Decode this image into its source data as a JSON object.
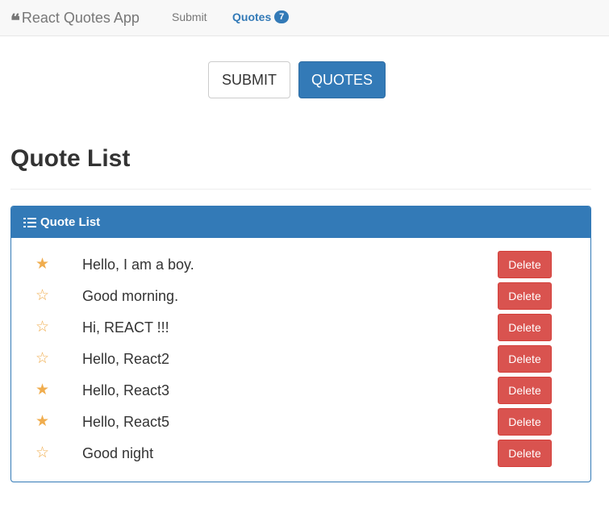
{
  "navbar": {
    "brand": "React Quotes App",
    "brand_icon": "quote-left-icon",
    "links": [
      {
        "label": "Submit"
      },
      {
        "label": "Quotes",
        "badge": "7"
      }
    ]
  },
  "buttons": {
    "submit_label": "SUBMIT",
    "quotes_label": "QUOTES"
  },
  "page_title": "Quote List",
  "panel": {
    "title": "Quote List",
    "icon": "list-icon"
  },
  "quotes": [
    {
      "text": "Hello, I am a boy.",
      "starred": true,
      "delete_label": "Delete"
    },
    {
      "text": "Good morning.",
      "starred": false,
      "delete_label": "Delete"
    },
    {
      "text": "Hi, REACT !!!",
      "starred": false,
      "delete_label": "Delete"
    },
    {
      "text": "Hello, React2",
      "starred": false,
      "delete_label": "Delete"
    },
    {
      "text": "Hello, React3",
      "starred": true,
      "delete_label": "Delete"
    },
    {
      "text": "Hello, React5",
      "starred": true,
      "delete_label": "Delete"
    },
    {
      "text": "Good night",
      "starred": false,
      "delete_label": "Delete"
    }
  ],
  "colors": {
    "primary": "#337ab7",
    "danger": "#d9534f",
    "star": "#f0ad4e"
  }
}
